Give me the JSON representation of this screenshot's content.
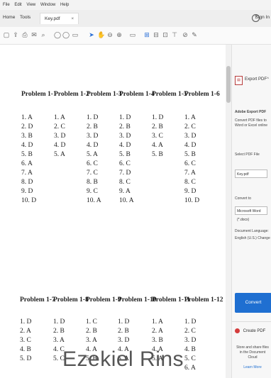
{
  "menu": {
    "items": [
      "File",
      "Edit",
      "View",
      "Window",
      "Help"
    ]
  },
  "tabs": {
    "home": "Home",
    "tools": "Tools",
    "document": "Key.pdf",
    "close": "×"
  },
  "header": {
    "help_icon": "?",
    "sign_in": "Sign In"
  },
  "toolbar": {
    "icons": [
      "file-icon",
      "upload-icon",
      "print-icon",
      "email-icon",
      "search-icon",
      "up-icon",
      "down-icon",
      "page-input",
      "cursor-icon",
      "hand-icon",
      "zoom-out-icon",
      "zoom-in-icon",
      "zoom-level",
      "fit-icon",
      "rotate-icon",
      "comment-icon",
      "highlight-icon",
      "draw-icon",
      "sign-icon"
    ]
  },
  "answer_key": {
    "group1": [
      {
        "header": "Problem 1-1",
        "answers": [
          "1. A",
          "2. D",
          "3. B",
          "4. D",
          "5. B",
          "6. A",
          "7. A",
          "8. D",
          "9. D",
          "10. D"
        ]
      },
      {
        "header": "Problem 1-2",
        "answers": [
          "1. A",
          "2. C",
          "3. D",
          "4. D",
          "5. A"
        ]
      },
      {
        "header": "Problem 1-3",
        "answers": [
          "1. D",
          "2. B",
          "3. D",
          "4. D",
          "5. A",
          "6. C",
          "7. C",
          "8. B",
          "9. C",
          "10. A"
        ]
      },
      {
        "header": "Problem 1-4",
        "answers": [
          "1. D",
          "2. B",
          "3. D",
          "4. D",
          "5. B",
          "6. C",
          "7. D",
          "8. C",
          "9. A",
          "10. A"
        ]
      },
      {
        "header": "Problem 1-5",
        "answers": [
          "1. D",
          "2. B",
          "3. C",
          "4. A",
          "5. B"
        ]
      },
      {
        "header": "Problem 1-6",
        "answers": [
          "1. A",
          "2. C",
          "3. D",
          "4. D",
          "5. B",
          "6. C",
          "7. A",
          "8. C",
          "9. D",
          "10. D"
        ]
      }
    ],
    "group2": [
      {
        "header": "Problem 1-7",
        "answers": [
          "1. D",
          "2. A",
          "3. C",
          "4. B",
          "5. D"
        ]
      },
      {
        "header": "Problem 1-8",
        "answers": [
          "1. D",
          "2. B",
          "3. A",
          "4. C",
          "5. C"
        ]
      },
      {
        "header": "Problem 1-9",
        "answers": [
          "1. C",
          "2. B",
          "3. A",
          "4. A",
          "5. B"
        ]
      },
      {
        "header": "Problem 1-10",
        "answers": [
          "1. D",
          "2. B",
          "3. D",
          "4. A",
          "5. A"
        ]
      },
      {
        "header": "Problem 1-11",
        "answers": [
          "1. A",
          "2. A",
          "3. B",
          "4. A",
          "5. A"
        ]
      },
      {
        "header": "Problem 1-12",
        "answers": [
          "1. D",
          "2. C",
          "3. D",
          "4. B",
          "5. C",
          "6. A"
        ]
      }
    ]
  },
  "watermark": "Ezekiel Rins",
  "side_panel": {
    "export_label": "Export PDF",
    "export_caret": "^",
    "title": "Adobe Export PDF",
    "desc": "Convert PDF files to Word or Excel online",
    "select_label": "Select PDF File",
    "file_value": "Key.pdf",
    "convert_to_label": "Convert to",
    "convert_to_value": "Microsoft Word (*.docx)",
    "language_label": "Document Language:",
    "language_value": "English (U.S.) Change",
    "convert_button": "Convert",
    "adobe_label": "Create PDF",
    "store_text": "Store and share files in the Document Cloud",
    "learn_more": "Learn More"
  }
}
